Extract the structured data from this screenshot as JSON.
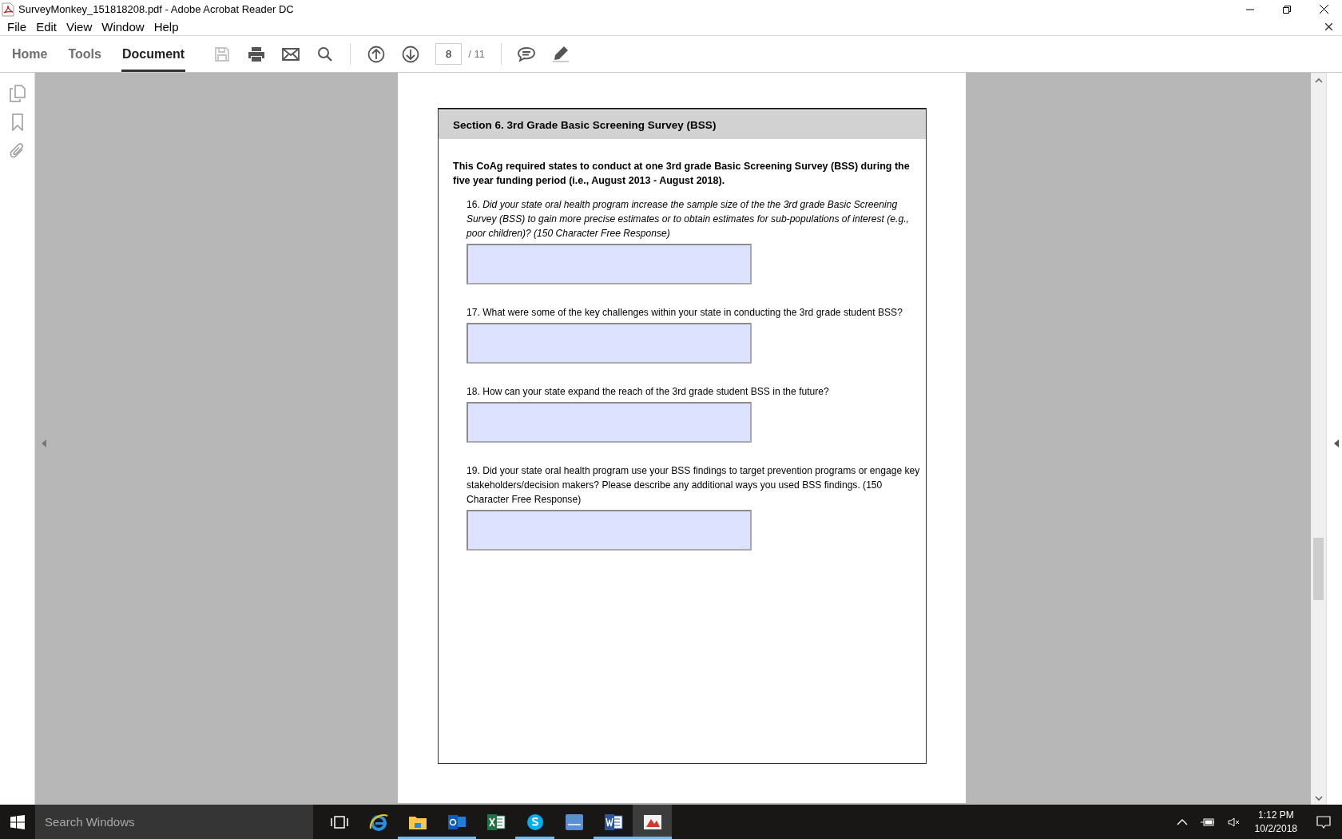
{
  "window": {
    "title": "SurveyMonkey_151818208.pdf - Adobe Acrobat Reader DC"
  },
  "menu": [
    "File",
    "Edit",
    "View",
    "Window",
    "Help"
  ],
  "tabs": [
    {
      "label": "Home",
      "selected": false
    },
    {
      "label": "Tools",
      "selected": false
    },
    {
      "label": "Document",
      "selected": true
    }
  ],
  "toolbar": [
    {
      "kind": "save",
      "disabled": true
    },
    {
      "kind": "print",
      "disabled": false
    },
    {
      "kind": "mail",
      "disabled": false
    },
    {
      "kind": "search",
      "disabled": false
    },
    {
      "kind": "sep"
    },
    {
      "kind": "up",
      "disabled": false
    },
    {
      "kind": "down",
      "disabled": false
    },
    {
      "kind": "page"
    },
    {
      "kind": "sep"
    },
    {
      "kind": "comment",
      "disabled": false
    },
    {
      "kind": "highlight",
      "disabled": false
    }
  ],
  "page_nav": {
    "current": "8",
    "total": "/ 11"
  },
  "document": {
    "section_title": "Section 6. 3rd Grade Basic Screening Survey (BSS)",
    "intro": "This CoAg required states to conduct at one 3rd grade Basic Screening Survey (BSS) during the five year funding period (i.e., August 2013 - August 2018).",
    "questions": [
      {
        "number": "16.",
        "text": "Did your state oral health program increase the sample size of the the 3rd grade Basic Screening Survey (BSS) to gain more precise estimates or to obtain estimates for sub-populations of interest (e.g., poor children)? (150 Character Free Response)",
        "italic": true
      },
      {
        "number": "17.",
        "text": "What were some of the key challenges within your state in conducting the 3rd grade student BSS?",
        "italic": false
      },
      {
        "number": "18.",
        "text": "How can your state expand the reach of the 3rd grade student BSS in the future?",
        "italic": false
      },
      {
        "number": "19.",
        "text": "Did your state oral health program use your BSS findings to target prevention programs or engage key stakeholders/decision makers?  Please describe any additional ways you used BSS findings. (150 Character Free Response)",
        "italic": false
      }
    ]
  },
  "taskbar": {
    "search_placeholder": "Search Windows",
    "apps": [
      {
        "kind": "taskview",
        "running": false
      },
      {
        "kind": "browser",
        "running": false
      },
      {
        "kind": "folder",
        "running": true
      },
      {
        "kind": "mail",
        "running": true
      },
      {
        "kind": "sheet",
        "running": false
      },
      {
        "kind": "chat",
        "running": true
      },
      {
        "kind": "stats",
        "running": false
      },
      {
        "kind": "doc",
        "running": true
      },
      {
        "kind": "reader",
        "running": true
      }
    ],
    "time": "1:12 PM",
    "date": "10/2/2018"
  }
}
